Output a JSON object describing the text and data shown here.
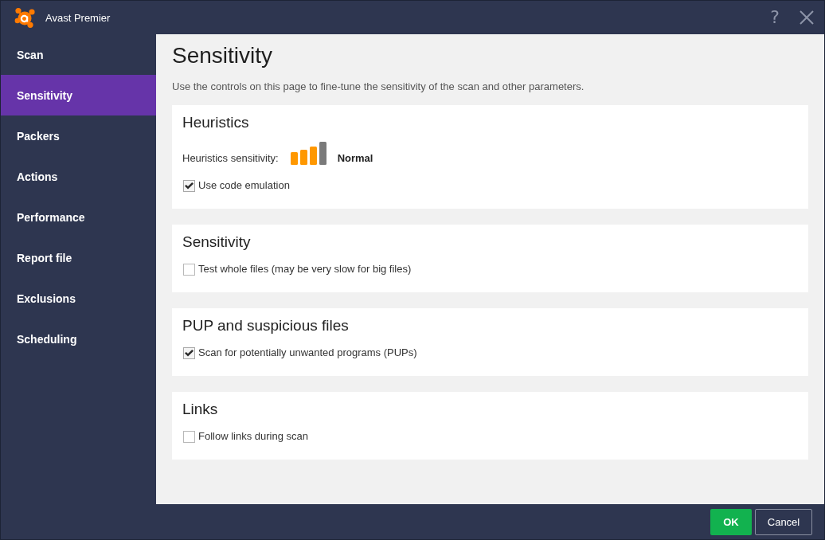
{
  "window": {
    "title": "Avast Premier",
    "help_button": "?"
  },
  "sidebar": {
    "items": [
      {
        "label": "Scan",
        "selected": false
      },
      {
        "label": "Sensitivity",
        "selected": true
      },
      {
        "label": "Packers",
        "selected": false
      },
      {
        "label": "Actions",
        "selected": false
      },
      {
        "label": "Performance",
        "selected": false
      },
      {
        "label": "Report file",
        "selected": false
      },
      {
        "label": "Exclusions",
        "selected": false
      },
      {
        "label": "Scheduling",
        "selected": false
      }
    ]
  },
  "content": {
    "title": "Sensitivity",
    "description": "Use the controls on this page to fine-tune the sensitivity of the scan and other parameters.",
    "sections": [
      {
        "heading": "Heuristics",
        "rows": [
          {
            "kind": "meter",
            "label": "Heuristics sensitivity:",
            "level": 0.75,
            "reading": "Normal"
          },
          {
            "kind": "checkbox",
            "label": "Use code emulation",
            "checked": true
          }
        ]
      },
      {
        "heading": "Sensitivity",
        "rows": [
          {
            "kind": "checkbox",
            "label": "Test whole files (may be very slow for big files)",
            "checked": false
          }
        ]
      },
      {
        "heading": "PUP and suspicious files",
        "rows": [
          {
            "kind": "checkbox",
            "label": "Scan for potentially unwanted programs (PUPs)",
            "checked": true
          }
        ]
      },
      {
        "heading": "Links",
        "rows": [
          {
            "kind": "checkbox",
            "label": "Follow links during scan",
            "checked": false
          }
        ]
      }
    ]
  },
  "buttons": [
    {
      "label": "OK",
      "kind": "primary"
    },
    {
      "label": "Cancel",
      "kind": "secondary"
    }
  ]
}
